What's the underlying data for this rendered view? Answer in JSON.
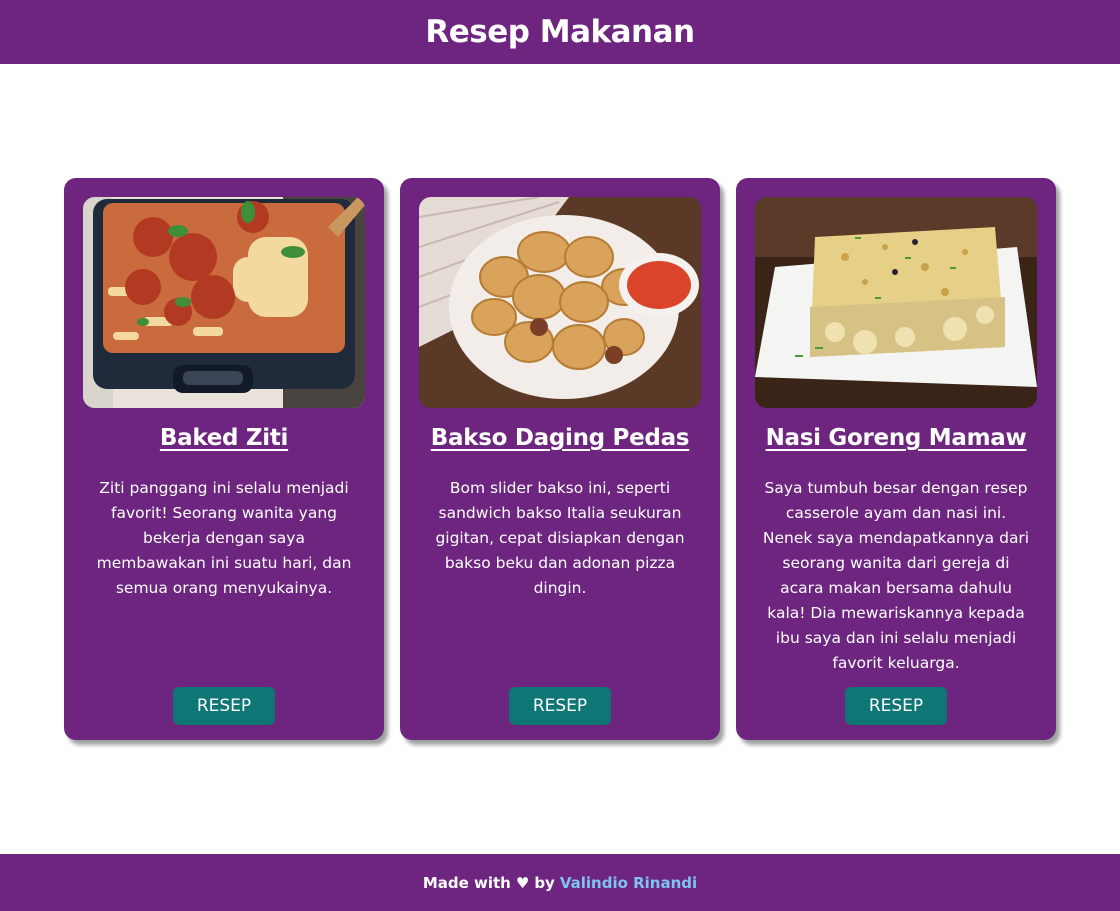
{
  "header": {
    "title": "Resep Makanan"
  },
  "cards": [
    {
      "image": "baked-ziti-photo",
      "title": "Baked Ziti",
      "description": "Ziti panggang ini selalu menjadi favorit! Seorang wanita yang bekerja dengan saya membawakan ini suatu hari, dan semua orang menyukainya.",
      "button_label": "RESEP"
    },
    {
      "image": "bakso-daging-pedas-photo",
      "title": "Bakso Daging Pedas",
      "description": "Bom slider bakso ini, seperti sandwich bakso Italia seukuran gigitan, cepat disiapkan dengan bakso beku dan adonan pizza dingin.",
      "button_label": "RESEP"
    },
    {
      "image": "nasi-goreng-mamaw-photo",
      "title": "Nasi Goreng Mamaw",
      "description": "Saya tumbuh besar dengan resep casserole ayam dan nasi ini. Nenek saya mendapatkannya dari seorang wanita dari gereja di acara makan bersama dahulu kala! Dia mewariskannya kepada ibu saya dan ini selalu menjadi favorit keluarga.",
      "button_label": "RESEP"
    }
  ],
  "footer": {
    "prefix": "Made with",
    "heart": "♥",
    "by": "by",
    "author": "Valindio Rinandi"
  },
  "colors": {
    "brand": "#6d2580",
    "button": "#0e7776",
    "link": "#7fc3f0"
  }
}
